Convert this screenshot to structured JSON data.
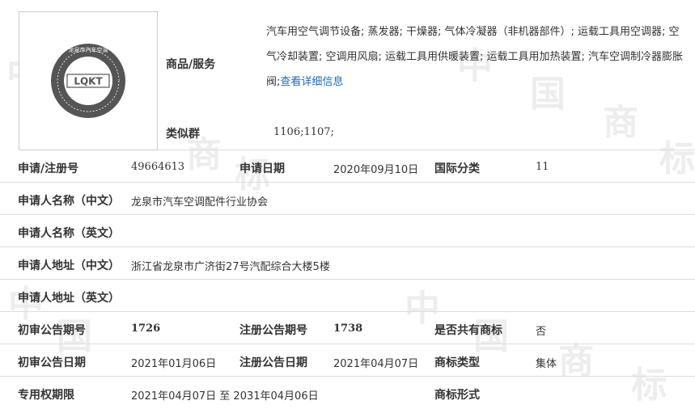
{
  "trademark": {
    "logo_text": "LQKT",
    "logo_ring_text": "龙泉市汽车空调",
    "logo_colors": {
      "ring": "#555555",
      "inner": "#ffffff"
    }
  },
  "goods": {
    "label": "商品/服务",
    "text": "汽车用空气调节设备; 蒸发器; 干燥器; 气体冷凝器（非机器部件）; 运载工具用空调器; 空气冷却装置; 空调用风扇; 运载工具用供暖装置; 运载工具用加热装置; 汽车空调制冷器膨胀阀;",
    "detail_link": "查看详细信息"
  },
  "similar_group": {
    "label": "类似群",
    "value": "1106;1107;"
  },
  "reg_number": {
    "label": "申请/注册号",
    "value": "49664613"
  },
  "app_date": {
    "label": "申请日期",
    "value": "2020年09月10日"
  },
  "intl_class": {
    "label": "国际分类",
    "value": "11"
  },
  "applicant_cn": {
    "label": "申请人名称（中文）",
    "value": "龙泉市汽车空调配件行业协会"
  },
  "applicant_en": {
    "label": "申请人名称（英文）",
    "value": ""
  },
  "address_cn": {
    "label": "申请人地址（中文）",
    "value": "浙江省龙泉市广济街27号汽配综合大楼5楼"
  },
  "address_en": {
    "label": "申请人地址（英文）",
    "value": ""
  },
  "prelim_issue": {
    "label": "初审公告期号",
    "value": "1726"
  },
  "reg_issue": {
    "label": "注册公告期号",
    "value": "1738"
  },
  "shared": {
    "label": "是否共有商标",
    "value": "否"
  },
  "prelim_date": {
    "label": "初审公告日期",
    "value": "2021年01月06日"
  },
  "reg_date": {
    "label": "注册公告日期",
    "value": "2021年04月07日"
  },
  "tm_type": {
    "label": "商标类型",
    "value": "集体"
  },
  "exclusive": {
    "label": "专用权期限",
    "value": "2021年04月07日 至 2031年04月06日"
  },
  "tm_form": {
    "label": "商标形式",
    "value": ""
  },
  "watermark": [
    "中",
    "国",
    "商",
    "标"
  ]
}
